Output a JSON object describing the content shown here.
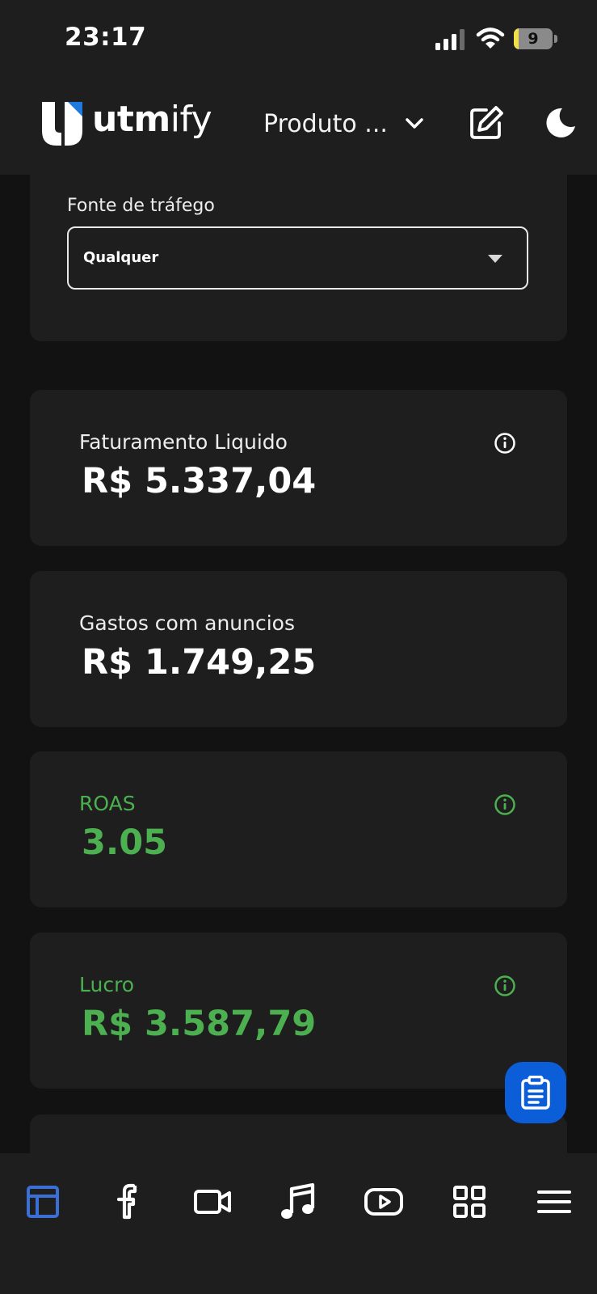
{
  "status_bar": {
    "time": "23:17",
    "battery_level": "9",
    "battery_fraction": 0.09
  },
  "header": {
    "logo_bold": "utm",
    "logo_light": "ify",
    "product_selector": "Produto ...",
    "icons": [
      "logo-mark-icon",
      "chevron-down-icon",
      "edit-icon",
      "moon-icon"
    ]
  },
  "filter": {
    "label": "Fonte de tráfego",
    "value": "Qualquer"
  },
  "metrics": [
    {
      "label": "Faturamento Liquido",
      "value": "R$ 5.337,04",
      "has_info": true,
      "color": "#ffffff"
    },
    {
      "label": "Gastos com anuncios",
      "value": "R$ 1.749,25",
      "has_info": false,
      "color": "#ffffff"
    },
    {
      "label": "ROAS",
      "value": "3.05",
      "has_info": true,
      "color": "#4caf50"
    },
    {
      "label": "Lucro",
      "value": "R$ 3.587,79",
      "has_info": true,
      "color": "#4caf50"
    }
  ],
  "fab": {
    "icon": "clipboard-icon",
    "color": "#0b5ed7"
  },
  "bottom_nav": {
    "active": "dashboard",
    "active_color": "#3a6fd8",
    "items": [
      "dashboard-icon",
      "facebook-icon",
      "video-camera-icon",
      "tiktok-music-icon",
      "youtube-icon",
      "grid-icon",
      "menu-icon"
    ]
  }
}
